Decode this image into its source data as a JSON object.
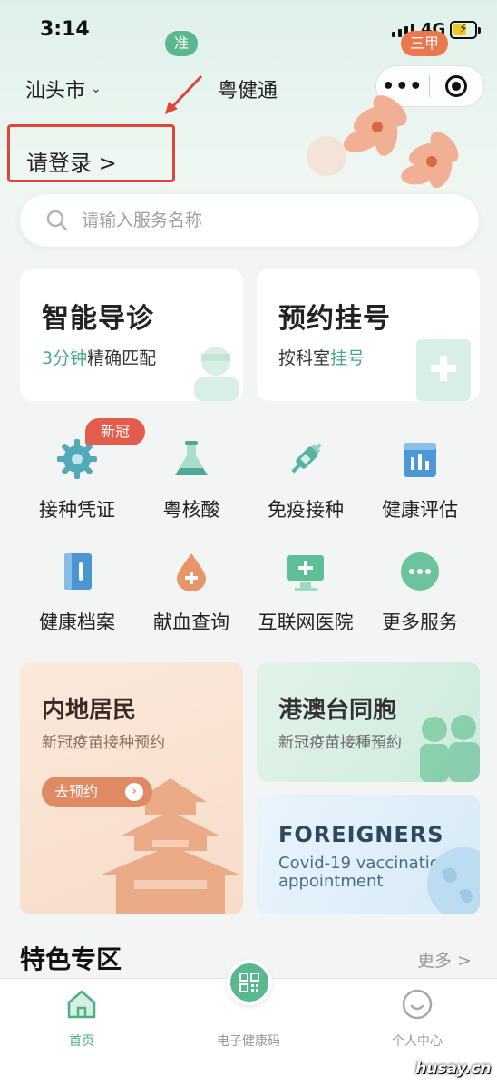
{
  "status": {
    "time": "3:14",
    "network": "4G"
  },
  "header": {
    "city": "汕头市",
    "title": "粤健通",
    "login": "请登录 >"
  },
  "search": {
    "placeholder": "请输入服务名称"
  },
  "cards": [
    {
      "title": "智能导诊",
      "badge": "准",
      "sub_highlight": "3分钟",
      "sub_rest": "精确匹配"
    },
    {
      "title": "预约挂号",
      "badge": "三甲",
      "sub_rest": "按科室",
      "sub_highlight": "挂号"
    }
  ],
  "new_tag": "新冠",
  "services": [
    {
      "label": "接种凭证",
      "icon": "gear-icon"
    },
    {
      "label": "粤核酸",
      "icon": "flask-icon"
    },
    {
      "label": "免疫接种",
      "icon": "syringe-icon"
    },
    {
      "label": "健康评估",
      "icon": "chart-board-icon"
    },
    {
      "label": "健康档案",
      "icon": "notebook-icon"
    },
    {
      "label": "献血查询",
      "icon": "blood-drop-icon"
    },
    {
      "label": "互联网医院",
      "icon": "monitor-plus-icon"
    },
    {
      "label": "更多服务",
      "icon": "more-dots-icon"
    }
  ],
  "promos": {
    "mainland": {
      "title": "内地居民",
      "sub": "新冠疫苗接种预约",
      "button": "去预约"
    },
    "hmt": {
      "title": "港澳台同胞",
      "sub": "新冠疫苗接種預約"
    },
    "foreigners": {
      "title": "FOREIGNERS",
      "sub": "Covid-19 vaccination appointment"
    }
  },
  "section": {
    "title": "特色专区",
    "more": "更多 >"
  },
  "tabs": [
    {
      "label": "首页",
      "icon": "home-icon"
    },
    {
      "label": "电子健康码",
      "icon": "qr-code-icon"
    },
    {
      "label": "个人中心",
      "icon": "user-face-icon"
    }
  ],
  "watermark": "husay.cn",
  "colors": {
    "accent": "#4caf85",
    "orange": "#e9784f",
    "red": "#e0443b"
  }
}
